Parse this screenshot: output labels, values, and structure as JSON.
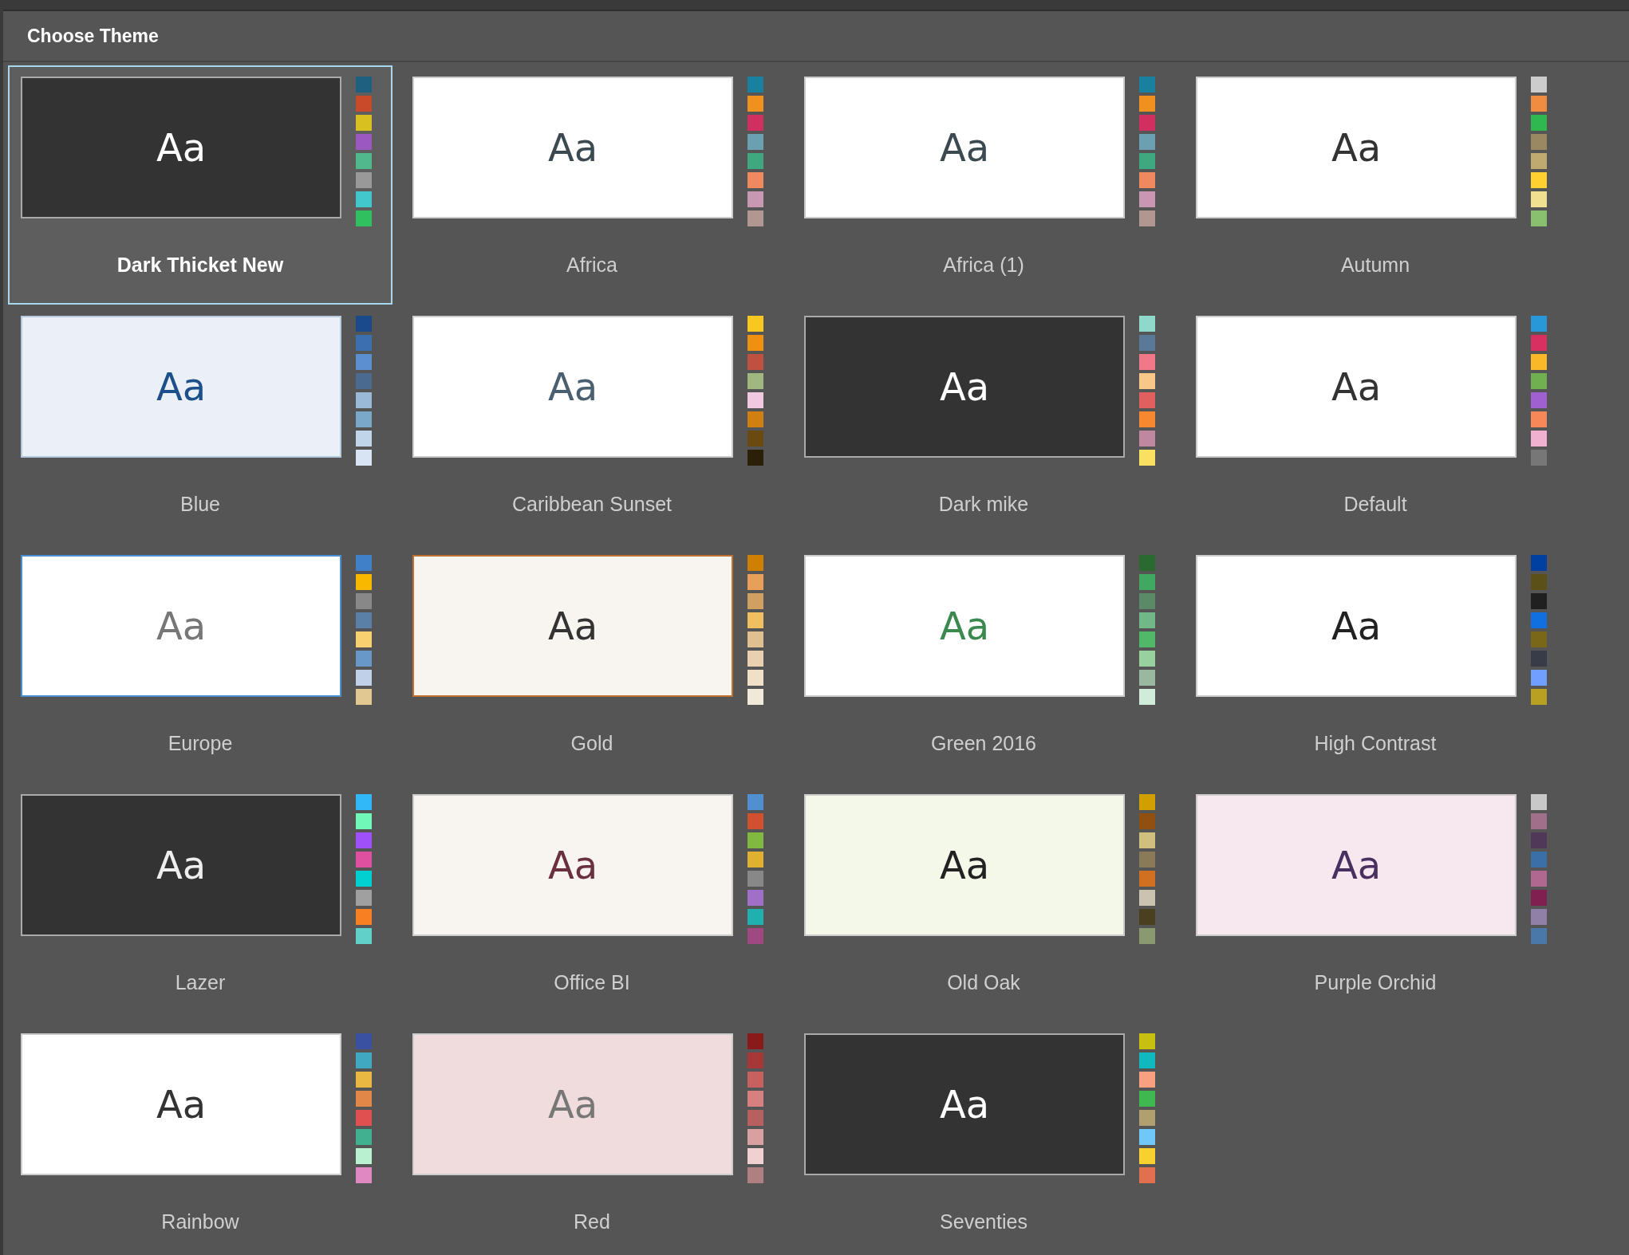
{
  "window": {
    "title": "Choose Theme"
  },
  "themes": [
    {
      "name": "Dark Thicket New",
      "selected": true,
      "sample": {
        "text": "Aa",
        "color": "#ffffff"
      },
      "preview": {
        "color": "#333333"
      },
      "frame": {
        "color": "#aaaaaa"
      },
      "swatches": [
        {
          "color": "#1f5f80"
        },
        {
          "color": "#c94a2a"
        },
        {
          "color": "#d8c020"
        },
        {
          "color": "#9b59c0"
        },
        {
          "color": "#50b88a"
        },
        {
          "color": "#999999"
        },
        {
          "color": "#40c8cc"
        },
        {
          "color": "#30c060"
        }
      ]
    },
    {
      "name": "Africa",
      "selected": false,
      "sample": {
        "text": "Aa",
        "color": "#3a4a50"
      },
      "preview": {
        "color": "#ffffff"
      },
      "frame": {
        "color": "#cccccc"
      },
      "swatches": [
        {
          "color": "#1a80a0"
        },
        {
          "color": "#f0901e"
        },
        {
          "color": "#d03060"
        },
        {
          "color": "#6aa0b0"
        },
        {
          "color": "#40a880"
        },
        {
          "color": "#f08860"
        },
        {
          "color": "#c898b0"
        },
        {
          "color": "#b09890"
        }
      ]
    },
    {
      "name": "Africa (1)",
      "selected": false,
      "sample": {
        "text": "Aa",
        "color": "#3a4a50"
      },
      "preview": {
        "color": "#ffffff"
      },
      "frame": {
        "color": "#cccccc"
      },
      "swatches": [
        {
          "color": "#1a80a0"
        },
        {
          "color": "#f0901e"
        },
        {
          "color": "#d03060"
        },
        {
          "color": "#6aa0b0"
        },
        {
          "color": "#40a880"
        },
        {
          "color": "#f08860"
        },
        {
          "color": "#c898b0"
        },
        {
          "color": "#b09890"
        }
      ]
    },
    {
      "name": "Autumn",
      "selected": false,
      "sample": {
        "text": "Aa",
        "color": "#333333"
      },
      "preview": {
        "color": "#ffffff"
      },
      "frame": {
        "color": "#cccccc"
      },
      "swatches": [
        {
          "color": "#cccccc"
        },
        {
          "color": "#f08c40"
        },
        {
          "color": "#30b850"
        },
        {
          "color": "#9a8860"
        },
        {
          "color": "#c0aa70"
        },
        {
          "color": "#ffd030"
        },
        {
          "color": "#f0e090"
        },
        {
          "color": "#88c070"
        }
      ]
    },
    {
      "name": "Blue",
      "selected": false,
      "sample": {
        "text": "Aa",
        "color": "#1d4f8a"
      },
      "preview": {
        "color": "#eaf0f6"
      },
      "frame": {
        "color": "#b8c8dc"
      },
      "swatches": [
        {
          "color": "#1a4a8a"
        },
        {
          "color": "#3a70b0"
        },
        {
          "color": "#5a90d0"
        },
        {
          "color": "#4a6a90"
        },
        {
          "color": "#9ab8d8"
        },
        {
          "color": "#7aa8c8"
        },
        {
          "color": "#c0d4ea"
        },
        {
          "color": "#d8e4f4"
        }
      ]
    },
    {
      "name": "Caribbean Sunset",
      "selected": false,
      "sample": {
        "text": "Aa",
        "color": "#4a6070"
      },
      "preview": {
        "color": "#ffffff"
      },
      "frame": {
        "color": "#cccccc"
      },
      "swatches": [
        {
          "color": "#f8c820"
        },
        {
          "color": "#f09010"
        },
        {
          "color": "#c05040"
        },
        {
          "color": "#a0b880"
        },
        {
          "color": "#f0c8e0"
        },
        {
          "color": "#d08010"
        },
        {
          "color": "#6a4a10"
        },
        {
          "color": "#2a2008"
        }
      ]
    },
    {
      "name": "Dark mike",
      "selected": false,
      "sample": {
        "text": "Aa",
        "color": "#ffffff"
      },
      "preview": {
        "color": "#333333"
      },
      "frame": {
        "color": "#aaaaaa"
      },
      "swatches": [
        {
          "color": "#90d8c8"
        },
        {
          "color": "#5a7898"
        },
        {
          "color": "#f07888"
        },
        {
          "color": "#f8c888"
        },
        {
          "color": "#e06060"
        },
        {
          "color": "#f88830"
        },
        {
          "color": "#c088a0"
        },
        {
          "color": "#f8e060"
        }
      ]
    },
    {
      "name": "Default",
      "selected": false,
      "sample": {
        "text": "Aa",
        "color": "#333333"
      },
      "preview": {
        "color": "#ffffff"
      },
      "frame": {
        "color": "#cccccc"
      },
      "swatches": [
        {
          "color": "#2898d8"
        },
        {
          "color": "#d83060"
        },
        {
          "color": "#f8b828"
        },
        {
          "color": "#70b050"
        },
        {
          "color": "#a060d0"
        },
        {
          "color": "#f88858"
        },
        {
          "color": "#f0b0d0"
        },
        {
          "color": "#777777"
        }
      ]
    },
    {
      "name": "Europe",
      "selected": false,
      "sample": {
        "text": "Aa",
        "color": "#777777"
      },
      "preview": {
        "color": "#ffffff"
      },
      "frame": {
        "color": "#4a90d0"
      },
      "swatches": [
        {
          "color": "#4080c8"
        },
        {
          "color": "#f8b800"
        },
        {
          "color": "#888888"
        },
        {
          "color": "#5a80a8"
        },
        {
          "color": "#f8d070"
        },
        {
          "color": "#6898c8"
        },
        {
          "color": "#c0d0e8"
        },
        {
          "color": "#e0c890"
        }
      ]
    },
    {
      "name": "Gold",
      "selected": false,
      "sample": {
        "text": "Aa",
        "color": "#333333"
      },
      "preview": {
        "color": "#f8f5f0"
      },
      "frame": {
        "color": "#c07030"
      },
      "swatches": [
        {
          "color": "#d08000"
        },
        {
          "color": "#e8a058"
        },
        {
          "color": "#d0a060"
        },
        {
          "color": "#f0c060"
        },
        {
          "color": "#e0c090"
        },
        {
          "color": "#e8d0b0"
        },
        {
          "color": "#f0e0c8"
        },
        {
          "color": "#f0e8d8"
        }
      ]
    },
    {
      "name": "Green 2016",
      "selected": false,
      "sample": {
        "text": "Aa",
        "color": "#3a8a50"
      },
      "preview": {
        "color": "#ffffff"
      },
      "frame": {
        "color": "#cccccc"
      },
      "swatches": [
        {
          "color": "#2a6a30"
        },
        {
          "color": "#40a860"
        },
        {
          "color": "#5a8a68"
        },
        {
          "color": "#70b888"
        },
        {
          "color": "#50b868"
        },
        {
          "color": "#98d0a0"
        },
        {
          "color": "#98b8a0"
        },
        {
          "color": "#d0ecd8"
        }
      ]
    },
    {
      "name": "High Contrast",
      "selected": false,
      "sample": {
        "text": "Aa",
        "color": "#222222"
      },
      "preview": {
        "color": "#ffffff"
      },
      "frame": {
        "color": "#cccccc"
      },
      "swatches": [
        {
          "color": "#0040a0"
        },
        {
          "color": "#5a5018"
        },
        {
          "color": "#202020"
        },
        {
          "color": "#1070e0"
        },
        {
          "color": "#7a6818"
        },
        {
          "color": "#383c48"
        },
        {
          "color": "#70a0ff"
        },
        {
          "color": "#b8a020"
        }
      ]
    },
    {
      "name": "Lazer",
      "selected": false,
      "sample": {
        "text": "Aa",
        "color": "#eeeeee"
      },
      "preview": {
        "color": "#333333"
      },
      "frame": {
        "color": "#aaaaaa"
      },
      "swatches": [
        {
          "color": "#30b8f8"
        },
        {
          "color": "#70f8b8"
        },
        {
          "color": "#a050f8"
        },
        {
          "color": "#e050a0"
        },
        {
          "color": "#00d0d0"
        },
        {
          "color": "#a0a0a0"
        },
        {
          "color": "#f88020"
        },
        {
          "color": "#60d0c8"
        }
      ]
    },
    {
      "name": "Office BI",
      "selected": false,
      "sample": {
        "text": "Aa",
        "color": "#6a3040"
      },
      "preview": {
        "color": "#f8f5f0"
      },
      "frame": {
        "color": "#cccccc"
      },
      "swatches": [
        {
          "color": "#5090d0"
        },
        {
          "color": "#d05030"
        },
        {
          "color": "#80b840"
        },
        {
          "color": "#e0b030"
        },
        {
          "color": "#888888"
        },
        {
          "color": "#a070c8"
        },
        {
          "color": "#20b0b0"
        },
        {
          "color": "#a04880"
        }
      ]
    },
    {
      "name": "Old Oak",
      "selected": false,
      "sample": {
        "text": "Aa",
        "color": "#222222"
      },
      "preview": {
        "color": "#f4f8e8"
      },
      "frame": {
        "color": "#cccccc"
      },
      "swatches": [
        {
          "color": "#d0a000"
        },
        {
          "color": "#905010"
        },
        {
          "color": "#d0c080"
        },
        {
          "color": "#8a7a58"
        },
        {
          "color": "#d07020"
        },
        {
          "color": "#c8c4b0"
        },
        {
          "color": "#4a4020"
        },
        {
          "color": "#8a9a70"
        }
      ]
    },
    {
      "name": "Purple Orchid",
      "selected": false,
      "sample": {
        "text": "Aa",
        "color": "#4a3060"
      },
      "preview": {
        "color": "#f6e8ee"
      },
      "frame": {
        "color": "#cccccc"
      },
      "swatches": [
        {
          "color": "#c8c8c8"
        },
        {
          "color": "#a07088"
        },
        {
          "color": "#503858"
        },
        {
          "color": "#3a70a8"
        },
        {
          "color": "#b06890"
        },
        {
          "color": "#802050"
        },
        {
          "color": "#9080a8"
        },
        {
          "color": "#4a78a8"
        }
      ]
    },
    {
      "name": "Rainbow",
      "selected": false,
      "sample": {
        "text": "Aa",
        "color": "#333333"
      },
      "preview": {
        "color": "#ffffff"
      },
      "frame": {
        "color": "#cccccc"
      },
      "swatches": [
        {
          "color": "#3a50a0"
        },
        {
          "color": "#40a8c0"
        },
        {
          "color": "#e8b840"
        },
        {
          "color": "#e08848"
        },
        {
          "color": "#e05050"
        },
        {
          "color": "#40b090"
        },
        {
          "color": "#b8f0d0"
        },
        {
          "color": "#e088c0"
        }
      ]
    },
    {
      "name": "Red",
      "selected": false,
      "sample": {
        "text": "Aa",
        "color": "#777777"
      },
      "preview": {
        "color": "#f0dcdc"
      },
      "frame": {
        "color": "#cccccc"
      },
      "swatches": [
        {
          "color": "#8a1a1a"
        },
        {
          "color": "#a83838"
        },
        {
          "color": "#c86060"
        },
        {
          "color": "#d88080"
        },
        {
          "color": "#b86060"
        },
        {
          "color": "#d8a0a0"
        },
        {
          "color": "#f0d0d0"
        },
        {
          "color": "#b08080"
        }
      ]
    },
    {
      "name": "Seventies",
      "selected": false,
      "sample": {
        "text": "Aa",
        "color": "#ffffff"
      },
      "preview": {
        "color": "#333333"
      },
      "frame": {
        "color": "#aaaaaa"
      },
      "swatches": [
        {
          "color": "#c8c010"
        },
        {
          "color": "#10b8c0"
        },
        {
          "color": "#f8a080"
        },
        {
          "color": "#40b850"
        },
        {
          "color": "#b0a070"
        },
        {
          "color": "#70c8f8"
        },
        {
          "color": "#f8d030"
        },
        {
          "color": "#e07050"
        }
      ]
    }
  ]
}
